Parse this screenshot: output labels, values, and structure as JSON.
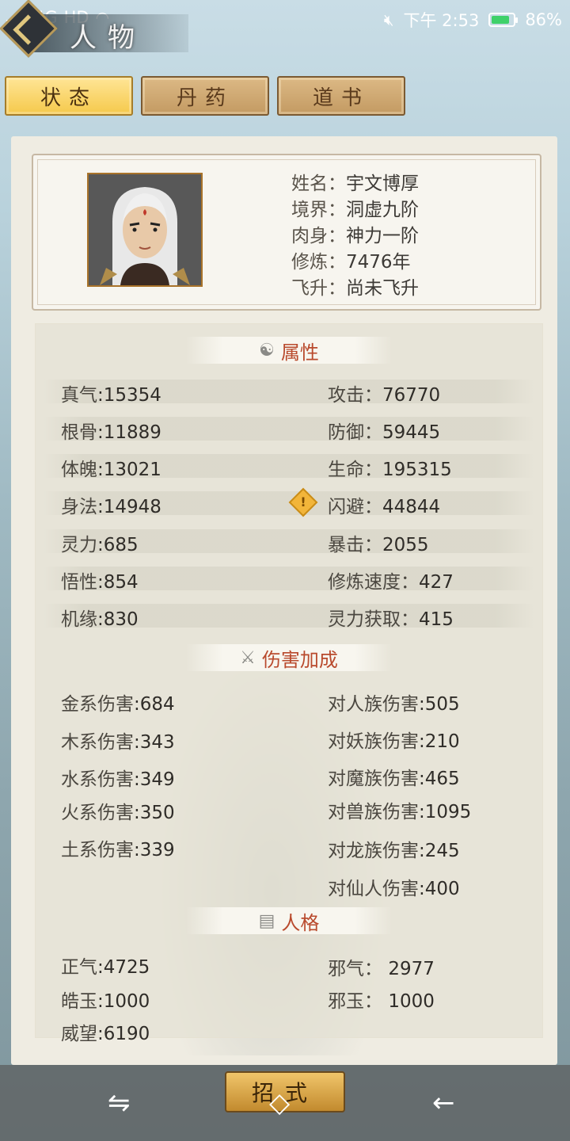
{
  "status_bar": {
    "network": "4G",
    "hd": "HD",
    "time": "下午 2:53",
    "battery": "86%",
    "battery_level": 0.86
  },
  "title": "人物",
  "tabs": [
    {
      "label": "状态",
      "active": true
    },
    {
      "label": "丹药",
      "active": false
    },
    {
      "label": "道书",
      "active": false
    }
  ],
  "profile": {
    "name_label": "姓名：",
    "name": "宇文博厚",
    "realm_label": "境界：",
    "realm": "洞虚九阶",
    "body_label": "肉身：",
    "body": "神力一阶",
    "cultivation_label": "修炼：",
    "cultivation": "7476年",
    "ascend_label": "飞升：",
    "ascend": "尚未飞升"
  },
  "attributes": {
    "title": "属性",
    "left": [
      {
        "key": "真气",
        "value": "15354"
      },
      {
        "key": "根骨",
        "value": "11889"
      },
      {
        "key": "体魄",
        "value": "13021"
      },
      {
        "key": "身法",
        "value": "14948"
      },
      {
        "key": "灵力",
        "value": "685"
      },
      {
        "key": "悟性",
        "value": "854"
      },
      {
        "key": "机缘",
        "value": "830"
      }
    ],
    "right": [
      {
        "key": "攻击：",
        "value": "76770"
      },
      {
        "key": "防御：",
        "value": "59445"
      },
      {
        "key": "生命：",
        "value": "195315"
      },
      {
        "key": "闪避：",
        "value": "44844"
      },
      {
        "key": "暴击：",
        "value": "2055"
      },
      {
        "key": "修炼速度：",
        "value": "427"
      },
      {
        "key": "灵力获取：",
        "value": "415"
      }
    ]
  },
  "damage": {
    "title": "伤害加成",
    "left": [
      {
        "key": "金系伤害",
        "value": "684"
      },
      {
        "key": "木系伤害",
        "value": "343"
      },
      {
        "key": "水系伤害",
        "value": "349"
      },
      {
        "key": "火系伤害",
        "value": "350"
      },
      {
        "key": "土系伤害",
        "value": "339"
      }
    ],
    "right": [
      {
        "key": "对人族伤害",
        "value": "505"
      },
      {
        "key": "对妖族伤害",
        "value": "210"
      },
      {
        "key": "对魔族伤害",
        "value": "465"
      },
      {
        "key": "对兽族伤害",
        "value": "1095"
      },
      {
        "key": "对龙族伤害",
        "value": "245"
      },
      {
        "key": "对仙人伤害",
        "value": "400"
      }
    ]
  },
  "personality": {
    "title": "人格",
    "left": [
      {
        "key": "正气",
        "value": "4725"
      },
      {
        "key": "皓玉",
        "value": "1000"
      },
      {
        "key": "威望",
        "value": "6190"
      }
    ],
    "right": [
      {
        "key": "邪气：",
        "value": "2977"
      },
      {
        "key": "邪玉：",
        "value": "1000"
      }
    ]
  },
  "bottom": {
    "skill_button": "招式"
  }
}
